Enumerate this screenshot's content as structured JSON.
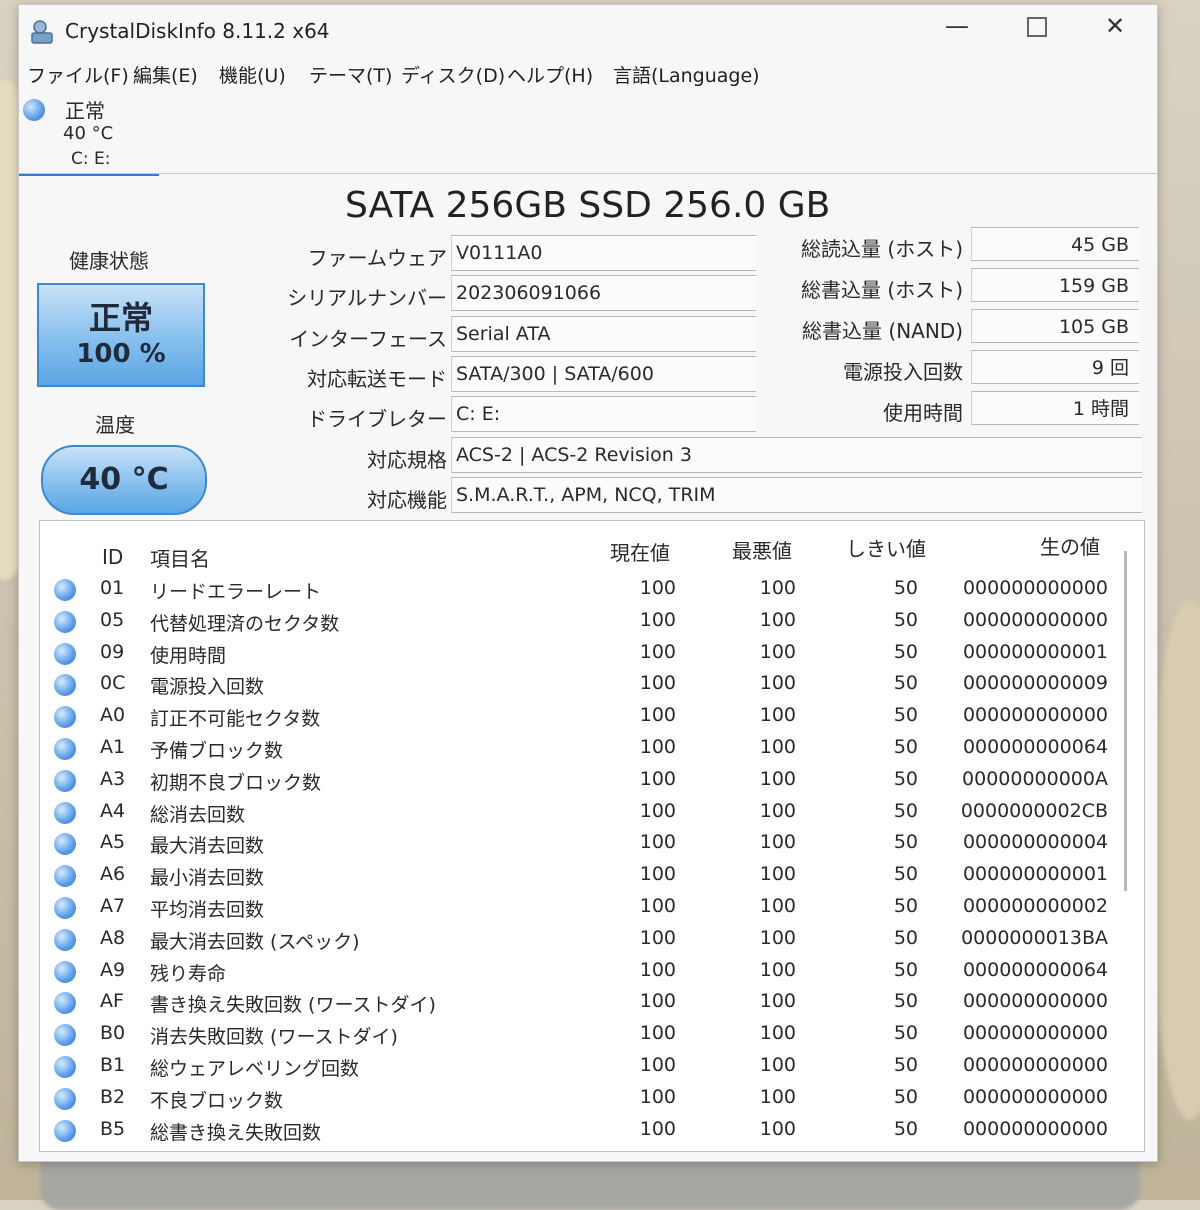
{
  "window": {
    "title": "CrystalDiskInfo 8.11.2 x64"
  },
  "controls": {
    "minimize": "—",
    "maximize": "",
    "close": "✕"
  },
  "menu": [
    "ファイル(F)",
    "編集(E)",
    "機能(U)",
    "テーマ(T)",
    "ディスク(D)",
    "ヘルプ(H)",
    "言語(Language)"
  ],
  "disk_tab": {
    "status": "正常",
    "temperature": "40 °C",
    "letters": "C: E:"
  },
  "drive": {
    "title": "SATA 256GB SSD 256.0 GB"
  },
  "health": {
    "label": "健康状態",
    "status": "正常",
    "percent": "100 %"
  },
  "temperature": {
    "label": "温度",
    "value": "40 °C"
  },
  "info": {
    "firmware": {
      "label": "ファームウェア",
      "value": "V0111A0"
    },
    "serial": {
      "label": "シリアルナンバー",
      "value": "202306091066"
    },
    "interface": {
      "label": "インターフェース",
      "value": "Serial ATA"
    },
    "transfer": {
      "label": "対応転送モード",
      "value": "SATA/300 | SATA/600"
    },
    "drive_letter": {
      "label": "ドライブレター",
      "value": "C: E:"
    },
    "standard": {
      "label": "対応規格",
      "value": "ACS-2 | ACS-2 Revision 3"
    },
    "features": {
      "label": "対応機能",
      "value": "S.M.A.R.T., APM, NCQ, TRIM"
    }
  },
  "stats": {
    "host_reads": {
      "label": "総読込量 (ホスト)",
      "value": "45 GB"
    },
    "host_writes": {
      "label": "総書込量 (ホスト)",
      "value": "159 GB"
    },
    "nand_writes": {
      "label": "総書込量 (NAND)",
      "value": "105 GB"
    },
    "power_on_count": {
      "label": "電源投入回数",
      "value": "9 回"
    },
    "power_on_hours": {
      "label": "使用時間",
      "value": "1 時間"
    }
  },
  "smart": {
    "headers": {
      "id": "ID",
      "name": "項目名",
      "current": "現在値",
      "worst": "最悪値",
      "threshold": "しきい値",
      "raw": "生の値"
    },
    "rows": [
      {
        "id": "01",
        "name": "リードエラーレート",
        "current": "100",
        "worst": "100",
        "threshold": "50",
        "raw": "000000000000"
      },
      {
        "id": "05",
        "name": "代替処理済のセクタ数",
        "current": "100",
        "worst": "100",
        "threshold": "50",
        "raw": "000000000000"
      },
      {
        "id": "09",
        "name": "使用時間",
        "current": "100",
        "worst": "100",
        "threshold": "50",
        "raw": "000000000001"
      },
      {
        "id": "0C",
        "name": "電源投入回数",
        "current": "100",
        "worst": "100",
        "threshold": "50",
        "raw": "000000000009"
      },
      {
        "id": "A0",
        "name": "訂正不可能セクタ数",
        "current": "100",
        "worst": "100",
        "threshold": "50",
        "raw": "000000000000"
      },
      {
        "id": "A1",
        "name": "予備ブロック数",
        "current": "100",
        "worst": "100",
        "threshold": "50",
        "raw": "000000000064"
      },
      {
        "id": "A3",
        "name": "初期不良ブロック数",
        "current": "100",
        "worst": "100",
        "threshold": "50",
        "raw": "00000000000A"
      },
      {
        "id": "A4",
        "name": "総消去回数",
        "current": "100",
        "worst": "100",
        "threshold": "50",
        "raw": "0000000002CB"
      },
      {
        "id": "A5",
        "name": "最大消去回数",
        "current": "100",
        "worst": "100",
        "threshold": "50",
        "raw": "000000000004"
      },
      {
        "id": "A6",
        "name": "最小消去回数",
        "current": "100",
        "worst": "100",
        "threshold": "50",
        "raw": "000000000001"
      },
      {
        "id": "A7",
        "name": "平均消去回数",
        "current": "100",
        "worst": "100",
        "threshold": "50",
        "raw": "000000000002"
      },
      {
        "id": "A8",
        "name": "最大消去回数 (スペック)",
        "current": "100",
        "worst": "100",
        "threshold": "50",
        "raw": "0000000013BA"
      },
      {
        "id": "A9",
        "name": "残り寿命",
        "current": "100",
        "worst": "100",
        "threshold": "50",
        "raw": "000000000064"
      },
      {
        "id": "AF",
        "name": "書き換え失敗回数 (ワーストダイ)",
        "current": "100",
        "worst": "100",
        "threshold": "50",
        "raw": "000000000000"
      },
      {
        "id": "B0",
        "name": "消去失敗回数 (ワーストダイ)",
        "current": "100",
        "worst": "100",
        "threshold": "50",
        "raw": "000000000000"
      },
      {
        "id": "B1",
        "name": "総ウェアレベリング回数",
        "current": "100",
        "worst": "100",
        "threshold": "50",
        "raw": "000000000000"
      },
      {
        "id": "B2",
        "name": "不良ブロック数",
        "current": "100",
        "worst": "100",
        "threshold": "50",
        "raw": "000000000000"
      },
      {
        "id": "B5",
        "name": "総書き換え失敗回数",
        "current": "100",
        "worst": "100",
        "threshold": "50",
        "raw": "000000000000"
      }
    ]
  }
}
